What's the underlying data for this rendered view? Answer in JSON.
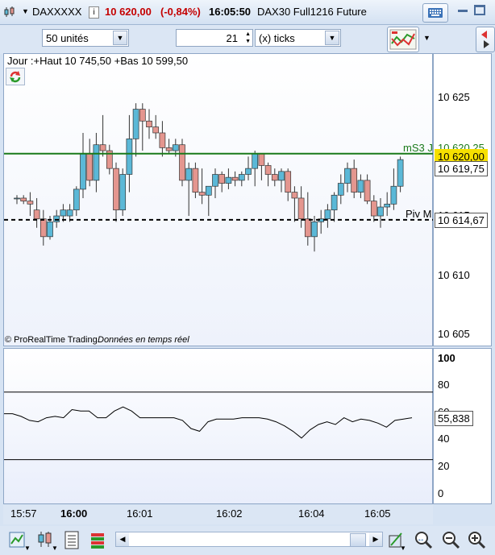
{
  "titlebar": {
    "symbol": "DAXXXXX",
    "price": "10 620,00",
    "change": "(-0,84%)",
    "time": "16:05:50",
    "instrument": "DAX30 Full1216 Future"
  },
  "toolbar": {
    "quantity": "50 unités",
    "period_value": "21",
    "period_unit": "(x) ticks"
  },
  "colors": {
    "up": "#5bb8d7",
    "down": "#e4968f",
    "line_level": "#1a7a1a",
    "bg_gradient": "#eef2fb"
  },
  "chart_data": [
    {
      "type": "candlestick",
      "header": "Jour :+Haut 10 745,50 +Bas 10 599,50",
      "copyright": "© ProRealTime Trading",
      "subtitle": "Données en temps réel",
      "ylim": [
        10604,
        10627.5
      ],
      "yticks": [
        "10 625",
        "10 620",
        "10 615",
        "10 610",
        "10 605"
      ],
      "ytick_values": [
        10625,
        10620,
        10615,
        10610,
        10605
      ],
      "levels": [
        {
          "name": "mS3 J",
          "value": 10620.25,
          "label": "10 620,25",
          "style": "solid"
        },
        {
          "name": "Piv M",
          "value": 10614.67,
          "label": "10 614,67",
          "style": "dashed"
        }
      ],
      "last_price_label": "10 620,00",
      "current_label": "10 619,75",
      "candles": [
        [
          10616.5,
          10616.75,
          10616.0,
          10616.5
        ],
        [
          10616.5,
          10616.75,
          10616.0,
          10616.25
        ],
        [
          10616.25,
          10617.0,
          10615.0,
          10616.0
        ],
        [
          10615.5,
          10616.5,
          10614.0,
          10614.75
        ],
        [
          10614.75,
          10615.5,
          10612.5,
          10613.25
        ],
        [
          10613.25,
          10615.0,
          10613.0,
          10614.5
        ],
        [
          10614.5,
          10615.5,
          10614.0,
          10615.0
        ],
        [
          10615.0,
          10616.0,
          10614.5,
          10615.5
        ],
        [
          10615.0,
          10616.0,
          10614.5,
          10615.5
        ],
        [
          10615.5,
          10617.5,
          10615.0,
          10617.25
        ],
        [
          10617.25,
          10622.0,
          10616.5,
          10620.25
        ],
        [
          10620.25,
          10621.5,
          10617.5,
          10618.0
        ],
        [
          10618.0,
          10622.0,
          10617.0,
          10621.0
        ],
        [
          10621.0,
          10623.5,
          10620.0,
          10620.5
        ],
        [
          10620.5,
          10621.0,
          10618.5,
          10619.0
        ],
        [
          10619.0,
          10619.5,
          10614.5,
          10615.5
        ],
        [
          10615.5,
          10619.0,
          10615.0,
          10618.5
        ],
        [
          10618.5,
          10623.5,
          10617.0,
          10621.5
        ],
        [
          10621.5,
          10624.5,
          10620.0,
          10624.0
        ],
        [
          10624.0,
          10624.5,
          10620.5,
          10623.0
        ],
        [
          10623.0,
          10624.0,
          10621.5,
          10622.5
        ],
        [
          10622.5,
          10623.5,
          10621.5,
          10622.0
        ],
        [
          10622.0,
          10623.0,
          10620.0,
          10620.75
        ],
        [
          10620.75,
          10621.5,
          10620.25,
          10620.5
        ],
        [
          10620.5,
          10621.5,
          10620.0,
          10621.0
        ],
        [
          10621.0,
          10621.5,
          10617.5,
          10618.0
        ],
        [
          10618.0,
          10619.5,
          10615.0,
          10619.0
        ],
        [
          10619.0,
          10619.5,
          10616.5,
          10617.0
        ],
        [
          10617.0,
          10619.0,
          10616.0,
          10616.75
        ],
        [
          10616.75,
          10617.5,
          10615.0,
          10617.5
        ],
        [
          10617.5,
          10619.0,
          10616.5,
          10618.5
        ],
        [
          10618.5,
          10618.75,
          10617.0,
          10617.75
        ],
        [
          10617.75,
          10619.0,
          10617.25,
          10618.25
        ],
        [
          10618.25,
          10618.75,
          10617.5,
          10618.0
        ],
        [
          10618.0,
          10618.75,
          10617.5,
          10618.5
        ],
        [
          10618.5,
          10620.0,
          10618.0,
          10619.0
        ],
        [
          10619.0,
          10620.5,
          10617.5,
          10620.25
        ],
        [
          10620.25,
          10620.25,
          10618.0,
          10619.25
        ],
        [
          10619.25,
          10619.5,
          10617.5,
          10618.5
        ],
        [
          10618.5,
          10619.0,
          10617.5,
          10618.0
        ],
        [
          10618.0,
          10619.0,
          10617.0,
          10618.75
        ],
        [
          10618.75,
          10619.0,
          10616.25,
          10617.0
        ],
        [
          10617.0,
          10617.5,
          10614.5,
          10616.5
        ],
        [
          10616.5,
          10617.5,
          10614.0,
          10614.75
        ],
        [
          10614.75,
          10617.0,
          10612.5,
          10613.25
        ],
        [
          10613.25,
          10615.0,
          10612.0,
          10614.5
        ],
        [
          10614.5,
          10615.5,
          10613.5,
          10614.75
        ],
        [
          10614.75,
          10616.0,
          10614.0,
          10615.5
        ],
        [
          10615.5,
          10617.0,
          10614.5,
          10616.75
        ],
        [
          10616.75,
          10618.5,
          10616.0,
          10617.75
        ],
        [
          10617.75,
          10619.5,
          10617.0,
          10619.0
        ],
        [
          10619.0,
          10619.75,
          10616.5,
          10617.0
        ],
        [
          10617.0,
          10618.5,
          10616.5,
          10618.0
        ],
        [
          10618.0,
          10618.5,
          10616.0,
          10616.25
        ],
        [
          10616.25,
          10616.75,
          10614.5,
          10615.0
        ],
        [
          10615.0,
          10616.5,
          10614.0,
          10615.75
        ],
        [
          10615.75,
          10617.0,
          10615.0,
          10616.0
        ],
        [
          10616.0,
          10619.0,
          10615.5,
          10617.5
        ],
        [
          10617.5,
          10620.0,
          10617.0,
          10619.75
        ]
      ]
    },
    {
      "type": "line",
      "ylim": [
        -8,
        107
      ],
      "yticks": [
        "100",
        "80",
        "60",
        "40",
        "20",
        "0"
      ],
      "ytick_values": [
        100,
        80,
        60,
        40,
        20,
        0
      ],
      "hlines": [
        75,
        25
      ],
      "current_label": "55,838",
      "values": [
        59,
        59,
        57,
        54,
        53,
        56,
        57,
        56,
        62,
        61,
        61,
        56,
        56,
        61,
        64,
        61,
        56,
        56,
        56,
        56,
        56,
        54,
        48,
        46,
        53,
        55,
        55,
        55,
        56,
        56,
        56,
        55,
        53,
        50,
        46,
        41,
        47,
        51,
        53,
        51,
        56,
        53,
        55,
        54,
        52,
        49,
        54,
        55,
        56
      ]
    }
  ],
  "time_axis": {
    "labels": [
      "15:57",
      "16:00",
      "16:01",
      "16:02",
      "16:04",
      "16:05"
    ],
    "bold_label": "16:00"
  }
}
